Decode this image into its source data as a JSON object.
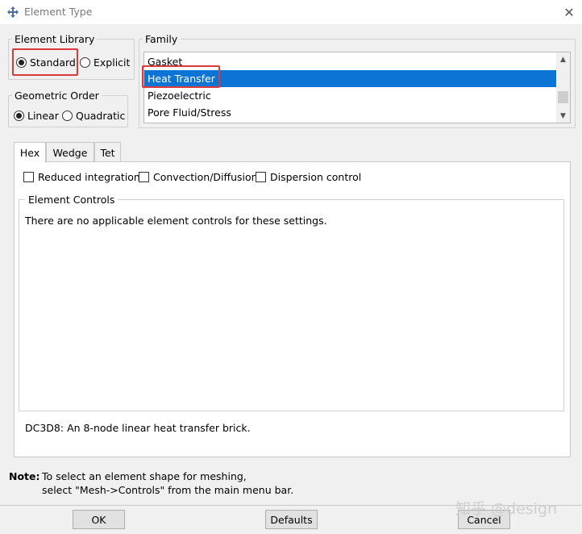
{
  "window": {
    "title": "Element Type"
  },
  "element_library": {
    "legend": "Element Library",
    "options": [
      "Standard",
      "Explicit"
    ],
    "selected": "Standard"
  },
  "family": {
    "legend": "Family",
    "items": [
      "Gasket",
      "Heat Transfer",
      "Piezoelectric",
      "Pore Fluid/Stress"
    ],
    "selected": "Heat Transfer"
  },
  "geometric_order": {
    "legend": "Geometric Order",
    "options": [
      "Linear",
      "Quadratic"
    ],
    "selected": "Linear"
  },
  "tabs": [
    "Hex",
    "Wedge",
    "Tet"
  ],
  "active_tab": "Hex",
  "checkboxes": [
    {
      "label": "Reduced integration",
      "checked": false
    },
    {
      "label": "Convection/Diffusion",
      "checked": false
    },
    {
      "label": "Dispersion control",
      "checked": false
    }
  ],
  "element_controls": {
    "legend": "Element Controls",
    "message": "There are no applicable element controls for these settings."
  },
  "element_description": "DC3D8:  An 8-node linear heat transfer brick.",
  "note": {
    "label": "Note:",
    "line1": "To select an element shape for meshing,",
    "line2": "select \"Mesh->Controls\" from the main menu bar."
  },
  "buttons": {
    "ok": "OK",
    "defaults": "Defaults",
    "cancel": "Cancel"
  },
  "watermark": "知乎 @design",
  "colors": {
    "selection": "#0c74d4",
    "highlight_box": "#d93a3a"
  }
}
